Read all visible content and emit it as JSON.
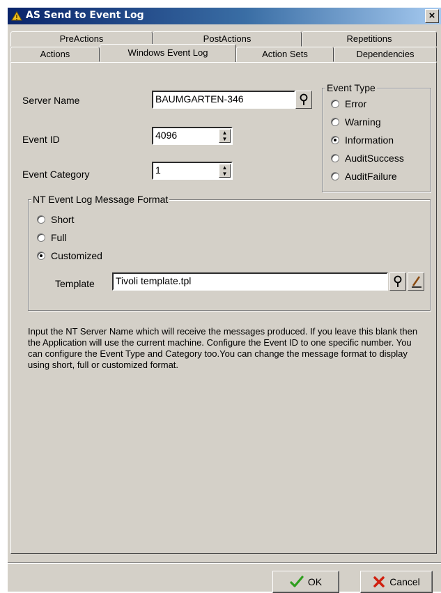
{
  "window": {
    "title": "AS Send to Event Log",
    "close_label": "×"
  },
  "tabs": {
    "back_row": [
      {
        "label": "PreActions"
      },
      {
        "label": "PostActions"
      },
      {
        "label": "Repetitions"
      }
    ],
    "front_row": [
      {
        "label": "Actions"
      },
      {
        "label": "Windows Event Log",
        "active": true
      },
      {
        "label": "Action Sets"
      },
      {
        "label": "Dependencies"
      }
    ]
  },
  "form": {
    "server_name": {
      "label": "Server Name",
      "value": "BAUMGARTEN-346"
    },
    "event_id": {
      "label": "Event ID",
      "value": "4096"
    },
    "event_category": {
      "label": "Event Category",
      "value": "1"
    }
  },
  "event_type": {
    "title": "Event Type",
    "options": [
      {
        "label": "Error",
        "checked": false
      },
      {
        "label": "Warning",
        "checked": false
      },
      {
        "label": "Information",
        "checked": true
      },
      {
        "label": "AuditSuccess",
        "checked": false
      },
      {
        "label": "AuditFailure",
        "checked": false
      }
    ]
  },
  "message_format": {
    "title": "NT Event Log Message Format",
    "options": [
      {
        "label": "Short",
        "checked": false
      },
      {
        "label": "Full",
        "checked": false
      },
      {
        "label": "Customized",
        "checked": true
      }
    ],
    "template_label": "Template",
    "template_value": "Tivoli template.tpl"
  },
  "description": "Input the NT Server Name which will receive the messages produced. If you leave this blank then the Application will use the current machine. Configure the Event ID to one specific number. You can configure the Event Type and Category too.You can change the message format to display using short, full or customized format.",
  "buttons": {
    "ok": "OK",
    "cancel": "Cancel"
  },
  "icons": {
    "title": "app-icon",
    "browse_server": "magnifier-icon",
    "browse_template": "magnifier-icon",
    "edit_template": "pencil-icon",
    "ok": "checkmark-icon",
    "cancel": "x-icon"
  },
  "colors": {
    "titlebar_start": "#0a246a",
    "titlebar_end": "#a6caf0",
    "face": "#d4d0c8",
    "ok_check": "#2e9e1e",
    "cancel_x": "#d02010"
  }
}
